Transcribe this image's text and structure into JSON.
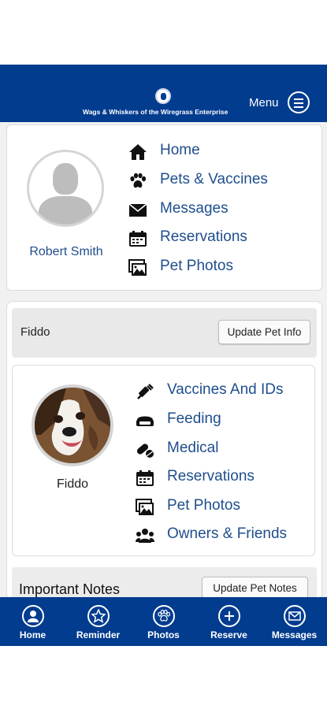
{
  "header": {
    "brand": "Wags & Whiskers of the Wiregrass Enterprise",
    "menu_label": "Menu",
    "logo_icon": "paw-logo-icon",
    "menu_icon": "hamburger-icon"
  },
  "profile": {
    "name": "Robert Smith",
    "avatar_icon": "default-user-avatar",
    "nav": [
      {
        "label": "Home",
        "icon": "home-icon"
      },
      {
        "label": "Pets & Vaccines",
        "icon": "paw-icon"
      },
      {
        "label": "Messages",
        "icon": "envelope-icon"
      },
      {
        "label": "Reservations",
        "icon": "calendar-icon"
      },
      {
        "label": "Pet Photos",
        "icon": "images-icon"
      }
    ]
  },
  "pet": {
    "name": "Fiddo",
    "update_info_label": "Update Pet Info",
    "photo_label": "Fiddo",
    "nav": [
      {
        "label": "Vaccines And IDs",
        "icon": "syringe-icon"
      },
      {
        "label": "Feeding",
        "icon": "food-bowl-icon"
      },
      {
        "label": "Medical",
        "icon": "pills-icon"
      },
      {
        "label": "Reservations",
        "icon": "calendar-icon"
      },
      {
        "label": "Pet Photos",
        "icon": "images-icon"
      },
      {
        "label": "Owners & Friends",
        "icon": "users-icon"
      }
    ]
  },
  "notes": {
    "title": "Important Notes",
    "update_label": "Update Pet Notes"
  },
  "bottom_nav": [
    {
      "label": "Home",
      "icon": "user-circle-icon"
    },
    {
      "label": "Reminder",
      "icon": "star-icon"
    },
    {
      "label": "Photos",
      "icon": "paw-icon"
    },
    {
      "label": "Reserve",
      "icon": "plus-icon"
    },
    {
      "label": "Messages",
      "icon": "envelope-icon"
    }
  ],
  "colors": {
    "primary": "#023c8f",
    "link": "#1f4e8c",
    "background": "#f1f1f1"
  }
}
